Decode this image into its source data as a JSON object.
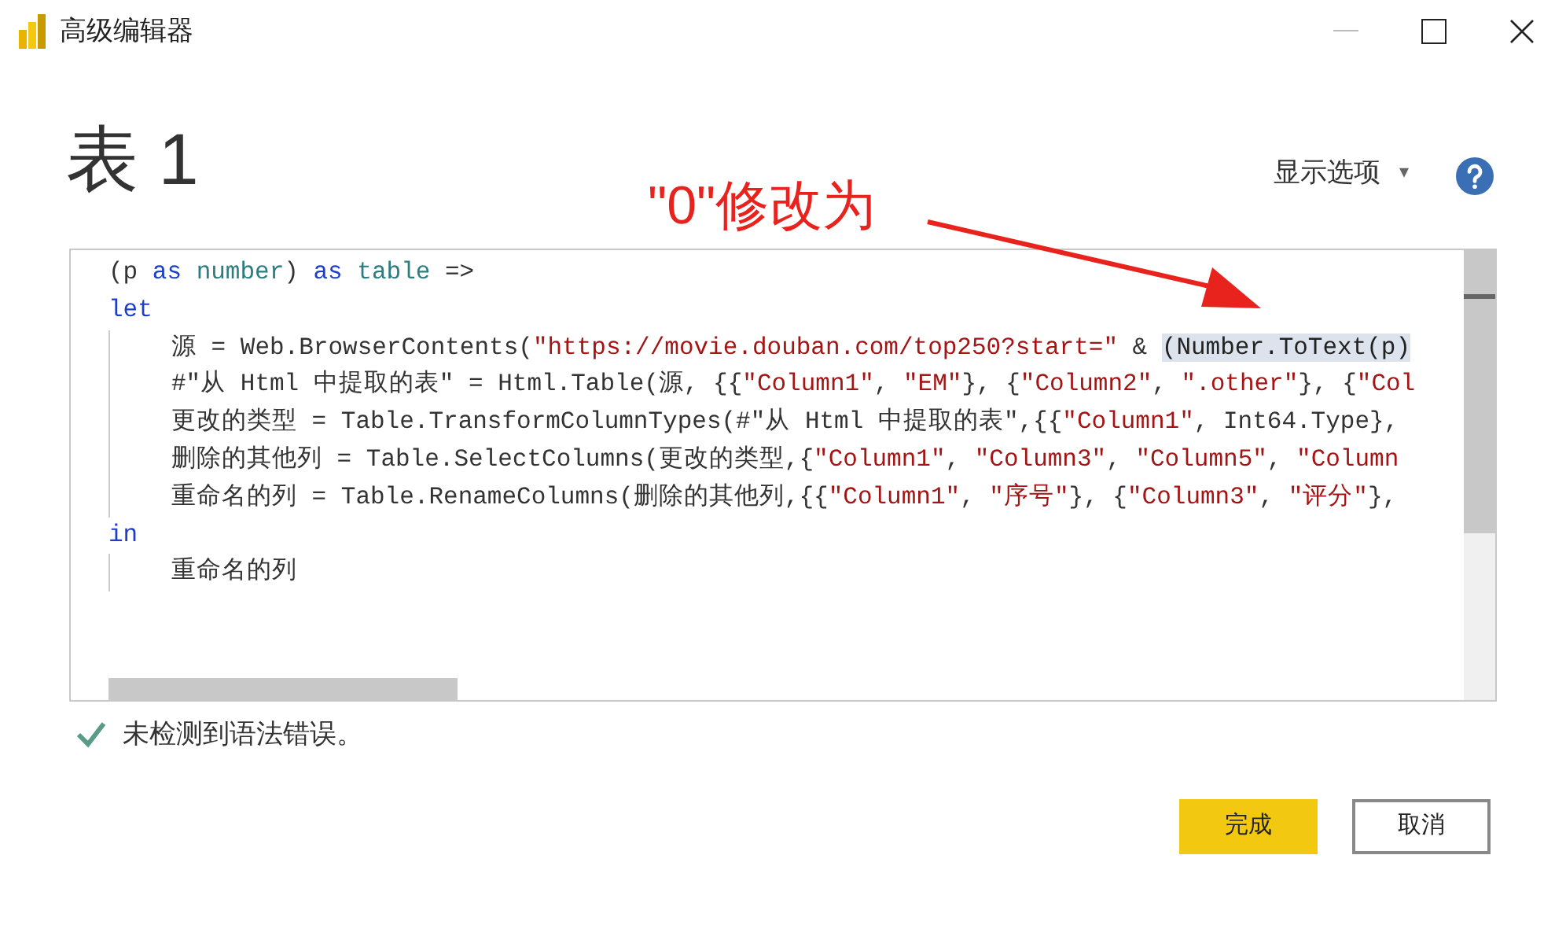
{
  "window": {
    "title": "高级编辑器"
  },
  "query_name": "表 1",
  "display_options": {
    "label": "显示选项",
    "caret": "▾"
  },
  "annotation": {
    "text": "\"0\"修改为"
  },
  "code": [
    {
      "tokens": [
        {
          "kind": "plain",
          "text": "(p "
        },
        {
          "kind": "keyword",
          "text": "as"
        },
        {
          "kind": "type",
          "text": " number"
        },
        {
          "kind": "plain",
          "text": ") "
        },
        {
          "kind": "keyword",
          "text": "as"
        },
        {
          "kind": "type",
          "text": " table"
        },
        {
          "kind": "plain",
          "text": " =>"
        }
      ]
    },
    {
      "tokens": [
        {
          "kind": "keyword",
          "text": "let"
        }
      ],
      "children": [
        {
          "tokens": [
            {
              "kind": "plain",
              "text": "源 = Web.BrowserContents("
            },
            {
              "kind": "string",
              "text": "\"https://movie.douban.com/top250?start=\""
            },
            {
              "kind": "plain",
              "text": " & "
            },
            {
              "kind": "highlight",
              "text": "(Number.ToText(p)"
            }
          ]
        },
        {
          "tokens": [
            {
              "kind": "plain",
              "text": "#\"从 Html 中提取的表\" = Html.Table(源, {{"
            },
            {
              "kind": "string",
              "text": "\"Column1\""
            },
            {
              "kind": "plain",
              "text": ", "
            },
            {
              "kind": "string",
              "text": "\"EM\""
            },
            {
              "kind": "plain",
              "text": "}, {"
            },
            {
              "kind": "string",
              "text": "\"Column2\""
            },
            {
              "kind": "plain",
              "text": ", "
            },
            {
              "kind": "string",
              "text": "\".other\""
            },
            {
              "kind": "plain",
              "text": "}, {"
            },
            {
              "kind": "string",
              "text": "\"Col"
            }
          ]
        },
        {
          "tokens": [
            {
              "kind": "plain",
              "text": "更改的类型 = Table.TransformColumnTypes(#\"从 Html 中提取的表\",{{"
            },
            {
              "kind": "string",
              "text": "\"Column1\""
            },
            {
              "kind": "plain",
              "text": ", Int64.Type},"
            }
          ]
        },
        {
          "tokens": [
            {
              "kind": "plain",
              "text": "删除的其他列 = Table.SelectColumns(更改的类型,{"
            },
            {
              "kind": "string",
              "text": "\"Column1\""
            },
            {
              "kind": "plain",
              "text": ", "
            },
            {
              "kind": "string",
              "text": "\"Column3\""
            },
            {
              "kind": "plain",
              "text": ", "
            },
            {
              "kind": "string",
              "text": "\"Column5\""
            },
            {
              "kind": "plain",
              "text": ", "
            },
            {
              "kind": "string",
              "text": "\"Column"
            }
          ]
        },
        {
          "tokens": [
            {
              "kind": "plain",
              "text": "重命名的列 = Table.RenameColumns(删除的其他列,{{"
            },
            {
              "kind": "string",
              "text": "\"Column1\""
            },
            {
              "kind": "plain",
              "text": ", "
            },
            {
              "kind": "string",
              "text": "\"序号\""
            },
            {
              "kind": "plain",
              "text": "}, {"
            },
            {
              "kind": "string",
              "text": "\"Column3\""
            },
            {
              "kind": "plain",
              "text": ", "
            },
            {
              "kind": "string",
              "text": "\"评分\""
            },
            {
              "kind": "plain",
              "text": "},"
            }
          ]
        }
      ]
    },
    {
      "tokens": [
        {
          "kind": "keyword",
          "text": "in"
        }
      ],
      "children": [
        {
          "tokens": [
            {
              "kind": "plain",
              "text": "重命名的列"
            }
          ]
        }
      ]
    }
  ],
  "status": {
    "text": "未检测到语法错误。"
  },
  "buttons": [
    {
      "label": "完成",
      "kind": "primary"
    },
    {
      "label": "取消",
      "kind": "secondary"
    }
  ]
}
